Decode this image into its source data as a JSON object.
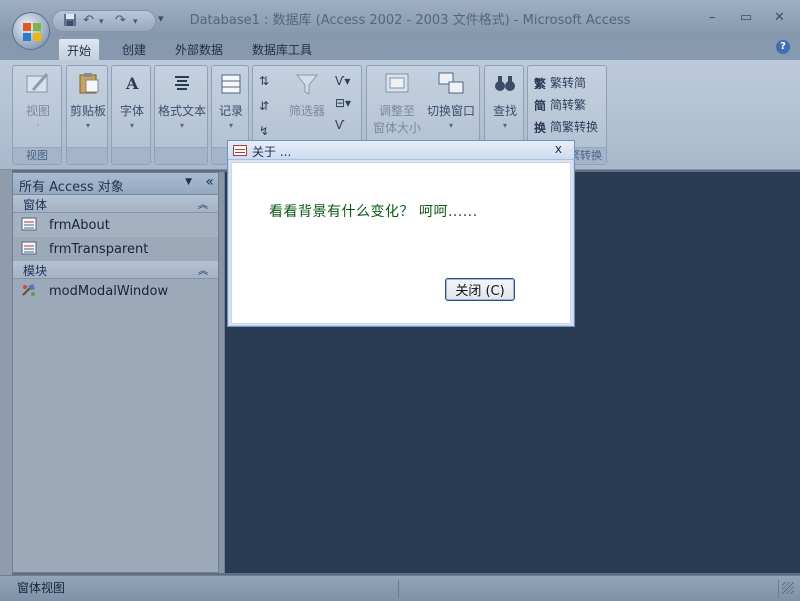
{
  "window": {
    "title": "Database1 : 数据库 (Access 2002 - 2003 文件格式) - Microsoft Access",
    "minimize": "–",
    "maximize": "▭",
    "close": "✕"
  },
  "qat": {
    "undo": "↶",
    "redo": "↷",
    "more": "▾"
  },
  "tabs": [
    {
      "label": "开始"
    },
    {
      "label": "创建"
    },
    {
      "label": "外部数据"
    },
    {
      "label": "数据库工具"
    }
  ],
  "ribbon": {
    "view": {
      "label": "视图",
      "group_label": "视图"
    },
    "clipboard": {
      "label": "剪贴板"
    },
    "font": {
      "label": "字体"
    },
    "rich_text": {
      "label": "格式文本"
    },
    "records": {
      "label": "记录"
    },
    "filter": {
      "label": "筛选器"
    },
    "size_to_fit": {
      "line1": "调整至",
      "line2": "窗体大小"
    },
    "switch_windows": {
      "label": "切换窗口"
    },
    "find": {
      "label": "查找"
    },
    "convert": {
      "to_traditional": "繁转简",
      "to_simplified": "简转繁",
      "convert": "简繁转换",
      "group_label_partial": "繁转换"
    }
  },
  "nav": {
    "header": "所有 Access 对象",
    "sections": [
      {
        "label": "窗体",
        "items": [
          {
            "label": "frmAbout"
          },
          {
            "label": "frmTransparent"
          }
        ]
      },
      {
        "label": "模块",
        "items": [
          {
            "label": "modModalWindow"
          }
        ]
      }
    ]
  },
  "dialog": {
    "title": "关于 ...",
    "close": "x",
    "message": "看看背景有什么变化？ 呵呵......",
    "button_label": "关闭 (C)"
  },
  "status": {
    "text": "窗体视图"
  },
  "colors": {
    "workspace": "#2a3c54",
    "message_text": "#0a5b12",
    "dialog_border": "#6f91c4"
  }
}
